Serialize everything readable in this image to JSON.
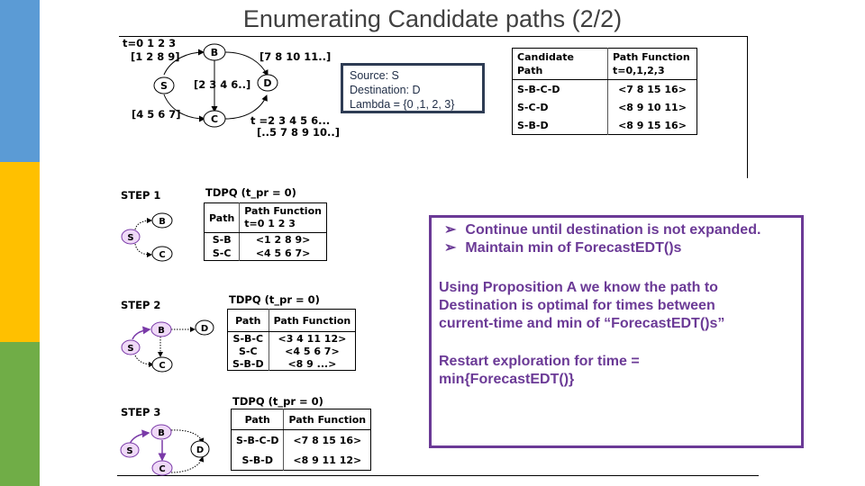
{
  "slide": {
    "title": "Enumerating Candidate paths (2/2)",
    "colors": {
      "bar_blue": "#5b9bd5",
      "bar_yellow": "#ffc000",
      "bar_green": "#70ad47",
      "accent_purple": "#6b3a96",
      "node_fill_purple": "#efd9f7",
      "box_navy": "#2e3c54",
      "title_gray": "#404040"
    }
  },
  "graph": {
    "nodes": [
      "S",
      "B",
      "C",
      "D"
    ],
    "time_label": "t=0 1 2 3",
    "edge_labels": {
      "S_B": "[1 2 8 9]",
      "S_C": "[4 5 6 7]",
      "B_C": "[2 3 4 6..]",
      "B_D": "[7 8 10 11..]",
      "C_D_time": "t =2 3 4 5  6...",
      "C_D": "[..5 7 8 9 10..]"
    }
  },
  "source_box": {
    "source": "Source: S",
    "destination": "Destination: D",
    "lambda": "Lambda = {0 ,1, 2, 3}"
  },
  "candidate_table": {
    "headers": [
      "Candidate Path",
      "Path Function t=0,1,2,3"
    ],
    "header_lines": [
      [
        "Candidate",
        "Path"
      ],
      [
        "Path Function",
        "t=0,1,2,3"
      ]
    ],
    "rows": [
      {
        "path": "S-B-C-D",
        "function": "<7 8 15 16>"
      },
      {
        "path": "S-C-D",
        "function": "<8 9 10 11>"
      },
      {
        "path": "S-B-D",
        "function": "<8 9 15 16>"
      }
    ]
  },
  "steps": [
    {
      "label": "STEP 1",
      "tdpq_title": "TDPQ (t_pr = 0)",
      "headers": [
        "Path",
        "Path Function"
      ],
      "header_sub": "t=0 1 2 3",
      "rows": [
        {
          "path": "S-B",
          "function": "<1 2 8 9>"
        },
        {
          "path": "S-C",
          "function": "<4 5 6 7>"
        }
      ]
    },
    {
      "label": "STEP 2",
      "tdpq_title": "TDPQ (t_pr = 0)",
      "headers": [
        "Path",
        "Path Function"
      ],
      "rows": [
        {
          "path": "S-B-C",
          "function": "<3 4 11 12>"
        },
        {
          "path": "S-C",
          "function": "<4 5 6 7>"
        },
        {
          "path": "S-B-D",
          "function": "<8 9 ...>"
        }
      ]
    },
    {
      "label": "STEP 3",
      "tdpq_title": "TDPQ (t_pr = 0)",
      "headers": [
        "Path",
        "Path Function"
      ],
      "rows": [
        {
          "path": "S-B-C-D",
          "function": "<7 8 15 16>"
        },
        {
          "path": "S-B-D",
          "function": "<8 9 11 12>"
        }
      ]
    }
  ],
  "notes": {
    "bullet_glyph": "➢",
    "bullets": [
      "Continue until destination is not expanded.",
      "Maintain min of ForecastEDT()s"
    ],
    "para1": [
      "Using Proposition A we know the path to",
      "Destination is optimal for times between",
      "current-time and min of “ForecastEDT()s”"
    ],
    "para2": [
      "Restart exploration for time =",
      "min{ForecastEDT()}"
    ]
  }
}
